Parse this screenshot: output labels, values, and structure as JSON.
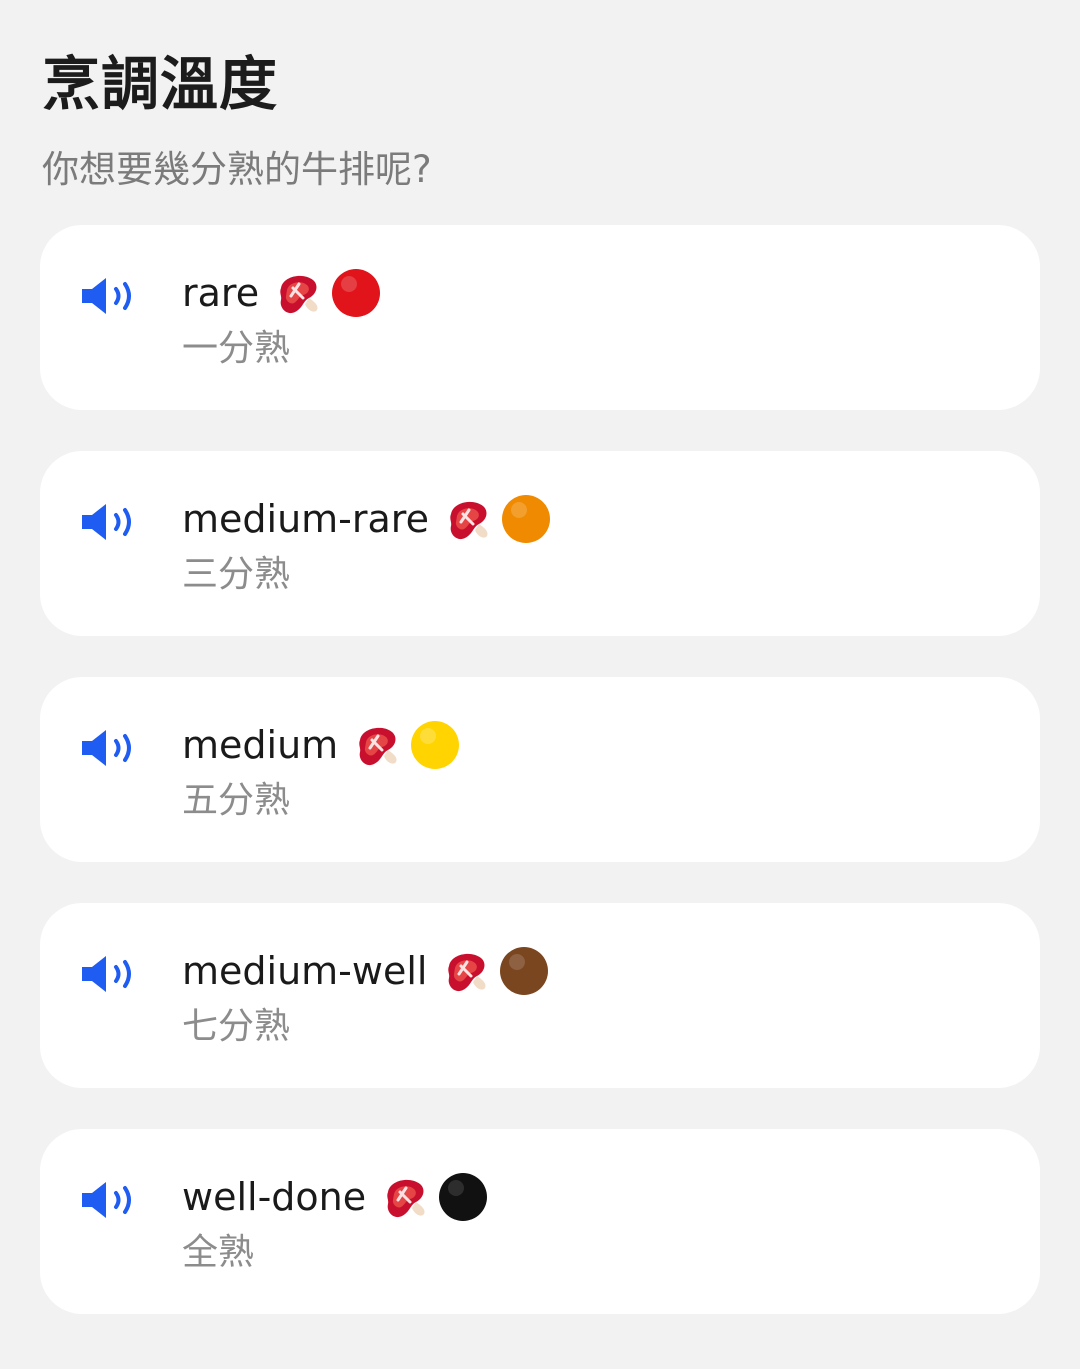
{
  "header": {
    "title": "烹調溫度",
    "subtitle": "你想要幾分熟的牛排呢?"
  },
  "items": [
    {
      "term": "rare",
      "translation": "一分熟",
      "icon": "steak-icon",
      "dot_icon": "red-circle-icon",
      "dot_color": "#e0141a"
    },
    {
      "term": "medium-rare",
      "translation": "三分熟",
      "icon": "steak-icon",
      "dot_icon": "orange-circle-icon",
      "dot_color": "#f08a00"
    },
    {
      "term": "medium",
      "translation": "五分熟",
      "icon": "steak-icon",
      "dot_icon": "yellow-circle-icon",
      "dot_color": "#ffd400"
    },
    {
      "term": "medium-well",
      "translation": "七分熟",
      "icon": "steak-icon",
      "dot_icon": "brown-circle-icon",
      "dot_color": "#7a4620"
    },
    {
      "term": "well-done",
      "translation": "全熟",
      "icon": "steak-icon",
      "dot_icon": "black-circle-icon",
      "dot_color": "#111111"
    }
  ],
  "colors": {
    "accent_speaker": "#1f5cf2",
    "background": "#f2f2f2",
    "card": "#ffffff"
  }
}
